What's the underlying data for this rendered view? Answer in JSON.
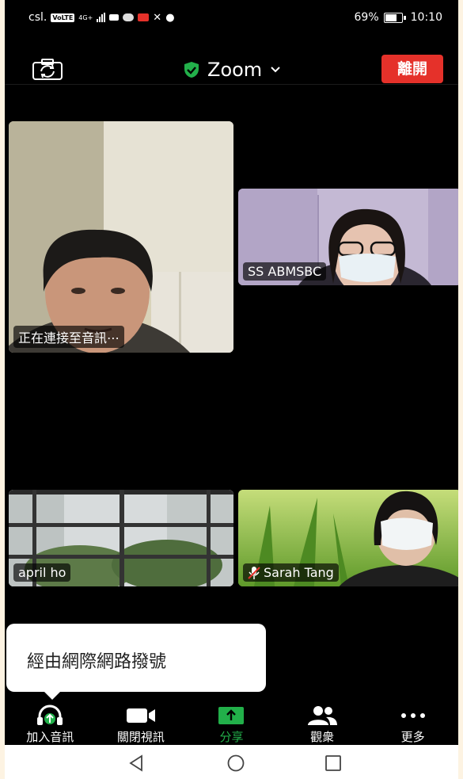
{
  "status_bar": {
    "carrier": "csl.",
    "volte": "VoLTE",
    "network": "4G+",
    "battery": "69%",
    "time": "10:10"
  },
  "top_bar": {
    "title": "Zoom",
    "leave_label": "離開"
  },
  "participants": [
    {
      "name": "正在連接至音訊⋯",
      "muted": false
    },
    {
      "name": "SS ABMSBC",
      "muted": false
    },
    {
      "name": "april ho",
      "muted": false
    },
    {
      "name": "Sarah Tang",
      "muted": true
    }
  ],
  "tooltip": {
    "text": "經由網際網路撥號"
  },
  "toolbar": {
    "items": [
      {
        "label": "加入音訊",
        "icon": "headphones-icon"
      },
      {
        "label": "關閉視訊",
        "icon": "video-camera-icon"
      },
      {
        "label": "分享",
        "icon": "share-screen-icon"
      },
      {
        "label": "觀衆",
        "icon": "participants-icon"
      },
      {
        "label": "更多",
        "icon": "more-icon"
      }
    ],
    "accent": "#22b04a"
  },
  "colors": {
    "leave_button": "#e5312a",
    "shield": "#22b04a"
  }
}
